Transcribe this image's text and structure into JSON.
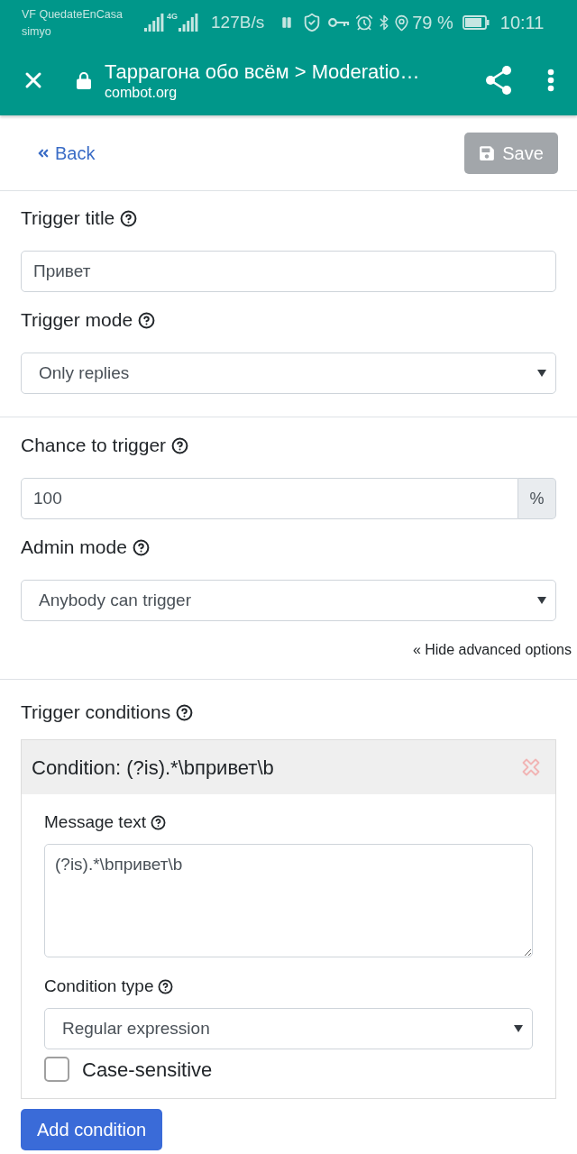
{
  "status_bar": {
    "carrier": "VF QuedateEnCasa",
    "carrier_sub": "simyo",
    "network_type": "4G",
    "data_speed": "127B/s",
    "battery": "79 %",
    "time": "10:11"
  },
  "browser_bar": {
    "title": "Таррагона обо всём > Moderatio…",
    "url": "combot.org"
  },
  "top_actions": {
    "back": "Back",
    "save": {
      "label": "Save",
      "disabled": true
    }
  },
  "sections": [
    {
      "fields": [
        {
          "kind": "text",
          "label": "Trigger title",
          "value": "Привет"
        },
        {
          "kind": "select",
          "label": "Trigger mode",
          "value": "Only replies"
        }
      ]
    },
    {
      "fields": [
        {
          "kind": "addon",
          "label": "Chance to trigger",
          "value": "100",
          "addon": "%"
        },
        {
          "kind": "select",
          "label": "Admin mode",
          "value": "Anybody can trigger"
        }
      ],
      "link": "« Hide advanced options"
    }
  ],
  "trigger_conditions": {
    "label": "Trigger conditions",
    "conditions": [
      {
        "title": "Condition: (?is).*\\bпривет\\b",
        "fields": [
          {
            "kind": "textarea",
            "label": "Message text",
            "value": "(?is).*\\bпривет\\b"
          },
          {
            "kind": "select",
            "label": "Condition type",
            "value": "Regular expression"
          },
          {
            "kind": "checkbox",
            "label": "Case-sensitive",
            "checked": false
          }
        ]
      }
    ],
    "button": "Add condition"
  }
}
